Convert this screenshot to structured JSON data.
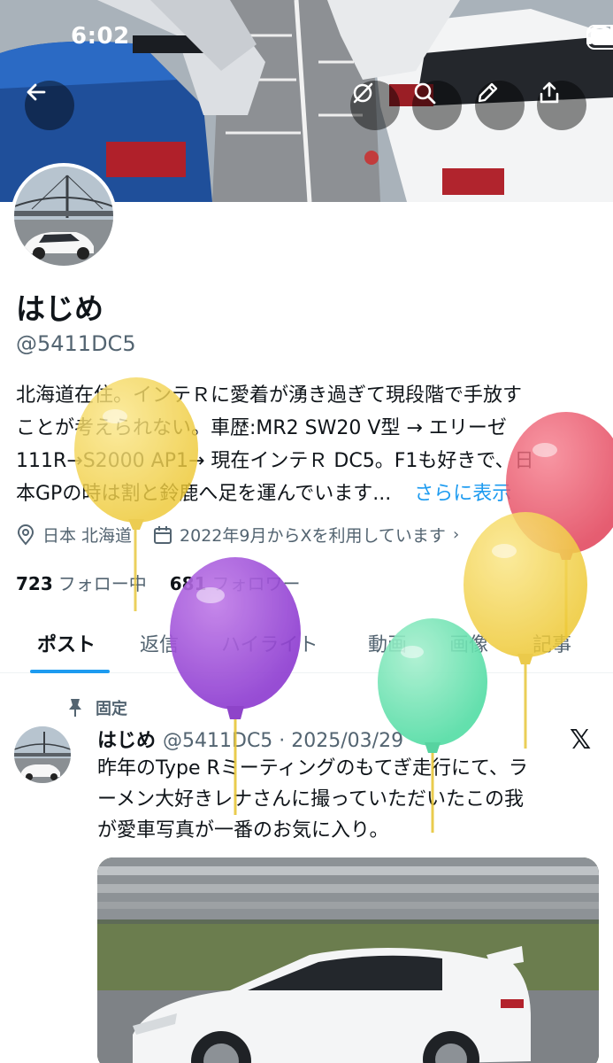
{
  "status": {
    "time": "6:02"
  },
  "profile": {
    "name": "はじめ",
    "handle": "@5411DC5",
    "bio_line1": "北海道在住。インテＲに愛着が湧き過ぎて現段階で手放す",
    "bio_line2": "ことが考えられない。車歴:MR2 SW20 V型 → エリーゼ",
    "bio_line3": "111R→S2000 AP1→ 現在インテＲ DC5。F1も好きで、日",
    "bio_line4": "本GPの時は割と鈴鹿へ足を運んでいます...",
    "bio_more": "さらに表示",
    "location": "日本 北海道",
    "joined": "2022年9月からXを利用しています",
    "following_count": "723",
    "following_label": "フォロー中",
    "followers_count": "681",
    "followers_label": "フォロワー"
  },
  "tabs": [
    "ポスト",
    "返信",
    "ハイライト",
    "動画",
    "画像",
    "記事"
  ],
  "post": {
    "pinned_label": "固定",
    "author": "はじめ",
    "handle_date": "@5411DC5 · 2025/03/29",
    "text_line1": "昨年のType  Rミーティングのもてぎ走行にて、ラ",
    "text_line2": "ーメン大好きレナさんに撮っていただいたこの我",
    "text_line3": "が愛車写真が一番のお気に入り。"
  },
  "icons": {
    "back": "back-arrow-icon",
    "grok": "grok-icon",
    "search": "search-icon",
    "edit": "pencil-icon",
    "share": "share-icon",
    "location": "location-pin-icon",
    "calendar": "calendar-icon",
    "pin": "pin-icon",
    "x": "x-logo-icon"
  },
  "colors": {
    "accent": "#1d9bf0",
    "text": "#0f1419",
    "secondary": "#536471"
  }
}
